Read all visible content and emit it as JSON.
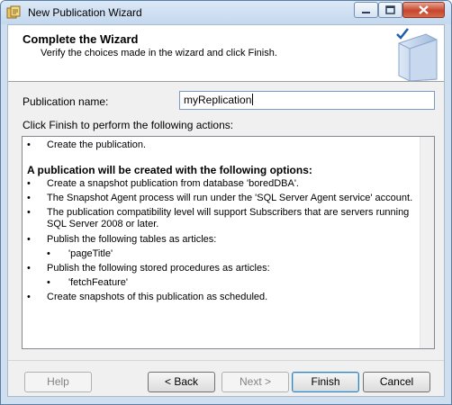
{
  "window": {
    "title": "New Publication Wizard"
  },
  "header": {
    "title": "Complete the Wizard",
    "subtitle": "Verify the choices made in the wizard and click Finish."
  },
  "form": {
    "publication_name_label": "Publication name:",
    "publication_name_value": "myReplication",
    "instructions": "Click Finish to perform the following actions:"
  },
  "actions": {
    "create": "Create the publication.",
    "options_heading": "A publication will be created with the following options:",
    "snapshot_db": "Create a snapshot publication from database 'boredDBA'.",
    "agent": "The Snapshot Agent process will run under the 'SQL Server Agent service' account.",
    "compat": "The publication compatibility level will support Subscribers that are servers running SQL Server 2008 or later.",
    "tables_heading": "Publish the following tables as articles:",
    "table_1": "'pageTitle'",
    "procs_heading": "Publish the following stored procedures as articles:",
    "proc_1": "'fetchFeature'",
    "snapshots": "Create snapshots of this publication as scheduled.",
    "bullet": "•"
  },
  "buttons": {
    "help": "Help",
    "back": "< Back",
    "next": "Next >",
    "finish": "Finish",
    "cancel": "Cancel"
  },
  "colors": {
    "close_button": "#c8452c",
    "title_bar": "#cfdff0",
    "input_border": "#7a9cc4"
  },
  "icons": {
    "app": "wizard-app-icon",
    "header": "book-checkmark-icon"
  }
}
